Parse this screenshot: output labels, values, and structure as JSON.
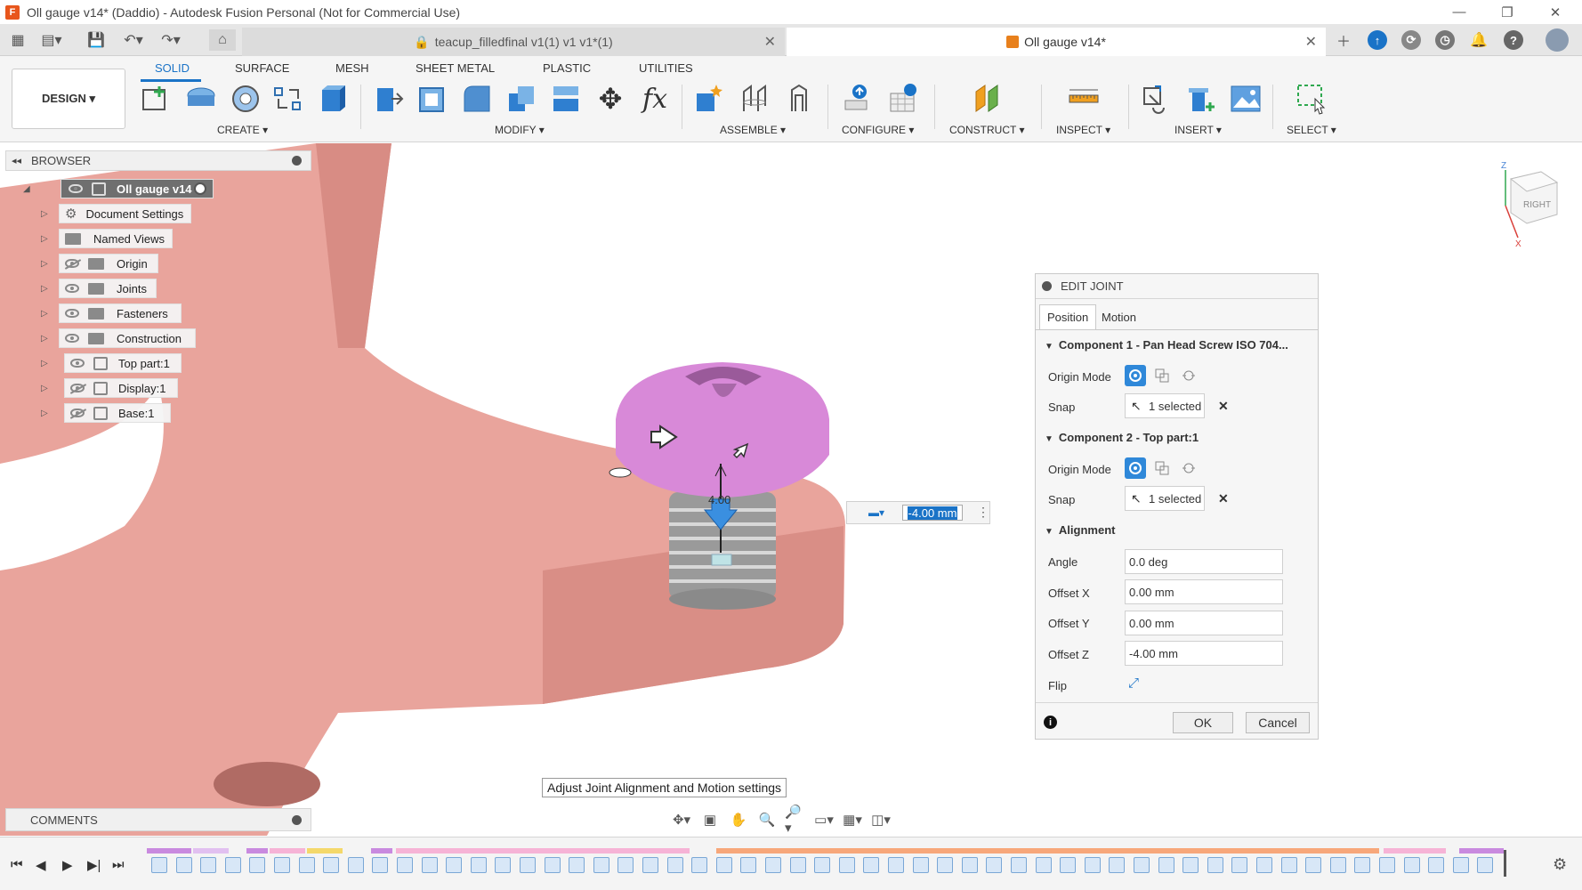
{
  "window": {
    "title": "Oll gauge v14* (Daddio) - Autodesk Fusion Personal (Not for Commercial Use)"
  },
  "tabs": {
    "inactive": {
      "label": "teacup_filledfinal v1(1) v1 v1*(1)"
    },
    "active": {
      "label": "Oll gauge v14*"
    }
  },
  "toolbar": {
    "workspace": "DESIGN ▾",
    "ribbon_tabs": [
      "SOLID",
      "SURFACE",
      "MESH",
      "SHEET METAL",
      "PLASTIC",
      "UTILITIES"
    ],
    "groups": [
      "CREATE ▾",
      "MODIFY ▾",
      "ASSEMBLE ▾",
      "CONFIGURE ▾",
      "CONSTRUCT ▾",
      "INSPECT ▾",
      "INSERT ▾",
      "SELECT ▾"
    ]
  },
  "browser": {
    "title": "BROWSER",
    "items": [
      {
        "label": "Oll gauge v14",
        "kind": "root"
      },
      {
        "label": "Document Settings",
        "kind": "settings"
      },
      {
        "label": "Named Views",
        "kind": "folder"
      },
      {
        "label": "Origin",
        "kind": "folder",
        "visibility": "hidden"
      },
      {
        "label": "Joints",
        "kind": "folder",
        "visibility": "visible"
      },
      {
        "label": "Fasteners",
        "kind": "folder",
        "visibility": "visible"
      },
      {
        "label": "Construction",
        "kind": "folder",
        "visibility": "visible"
      },
      {
        "label": "Top part:1",
        "kind": "component",
        "visibility": "visible"
      },
      {
        "label": "Display:1",
        "kind": "component",
        "visibility": "hidden"
      },
      {
        "label": "Base:1",
        "kind": "component",
        "visibility": "hidden"
      }
    ]
  },
  "viewcube": {
    "face": "RIGHT",
    "z_label": "Z",
    "x_label": "X"
  },
  "joint_panel": {
    "title": "EDIT JOINT",
    "tabs": [
      "Position",
      "Motion"
    ],
    "component1": {
      "header": "Component 1 - Pan Head Screw ISO 704...",
      "origin_mode_label": "Origin Mode",
      "snap_label": "Snap",
      "snap_value": "1 selected"
    },
    "component2": {
      "header": "Component 2 - Top part:1",
      "origin_mode_label": "Origin Mode",
      "snap_label": "Snap",
      "snap_value": "1 selected"
    },
    "alignment": {
      "header": "Alignment",
      "angle_label": "Angle",
      "angle_value": "0.0 deg",
      "offset_x_label": "Offset X",
      "offset_x_value": "0.00 mm",
      "offset_y_label": "Offset Y",
      "offset_y_value": "0.00 mm",
      "offset_z_label": "Offset Z",
      "offset_z_value": "-4.00 mm",
      "flip_label": "Flip"
    },
    "ok": "OK",
    "cancel": "Cancel"
  },
  "manipulator": {
    "value": "-4.00 mm",
    "dim_label": "4.00"
  },
  "tooltip": "Adjust Joint Alignment and Motion settings",
  "comments": {
    "title": "COMMENTS"
  },
  "colors": {
    "accent": "#1a73c7",
    "part": "#e9a49c",
    "screw_head": "#d889d8"
  }
}
